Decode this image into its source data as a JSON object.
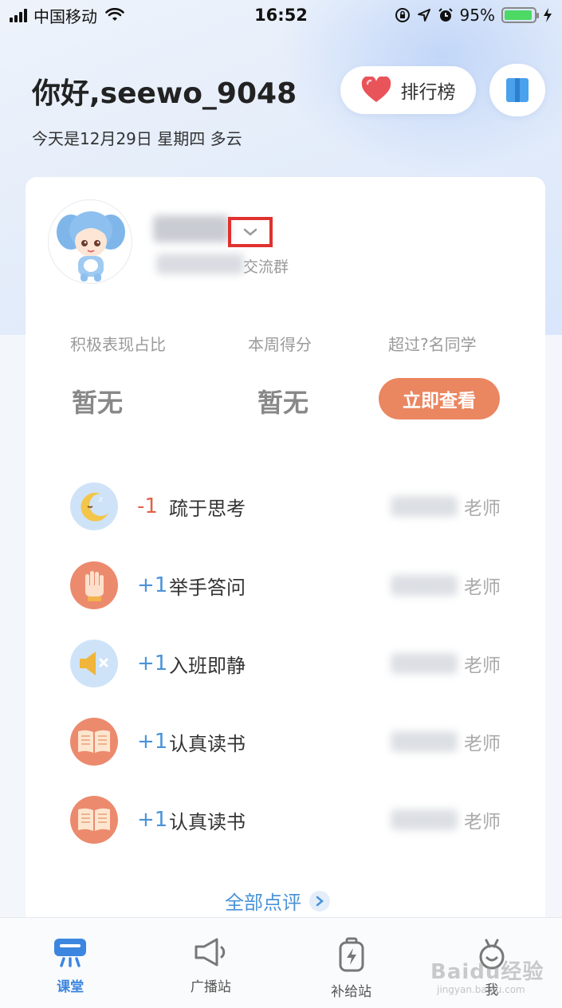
{
  "status_bar": {
    "carrier": "中国移动",
    "time": "16:52",
    "battery": "95%",
    "battery_level": 0.95
  },
  "header": {
    "greeting": "你好,seewo_9048",
    "date": "今天是12月29日 星期四 多云",
    "ranking_label": "排行榜"
  },
  "profile": {
    "group_suffix": "交流群"
  },
  "stats": [
    {
      "label": "积极表现占比",
      "value": "暂无"
    },
    {
      "label": "本周得分",
      "value": "暂无"
    },
    {
      "label": "超过?名同学",
      "action": "立即查看"
    }
  ],
  "records": [
    {
      "score": "-1",
      "title": "疏于思考",
      "teacher": "老师",
      "icon": "moon-icon",
      "color": "#f3c64a"
    },
    {
      "score": "+1",
      "title": "举手答问",
      "teacher": "老师",
      "icon": "raised-hand-icon",
      "color": "#e9735a"
    },
    {
      "score": "+1",
      "title": "入班即静",
      "teacher": "老师",
      "icon": "mute-speaker-icon",
      "color": "#f0b53a"
    },
    {
      "score": "+1",
      "title": "认真读书",
      "teacher": "老师",
      "icon": "open-book-icon",
      "color": "#e9735a"
    },
    {
      "score": "+1",
      "title": "认真读书",
      "teacher": "老师",
      "icon": "open-book-icon",
      "color": "#e9735a"
    }
  ],
  "all_reviews_label": "全部点评",
  "tabs": [
    {
      "label": "课堂",
      "icon": "classroom-icon",
      "active": true
    },
    {
      "label": "广播站",
      "icon": "speaker-icon",
      "active": false
    },
    {
      "label": "补给站",
      "icon": "battery-icon",
      "active": false
    },
    {
      "label": "我",
      "icon": "profile-icon",
      "active": false
    }
  ],
  "watermark": "Baidu经验",
  "watermark_sub": "jingyan.baidu.com",
  "colors": {
    "accent": "#4a93d8",
    "orange_button": "#ea8660",
    "highlight_box": "#e0312e",
    "negative": "#e0624a"
  }
}
